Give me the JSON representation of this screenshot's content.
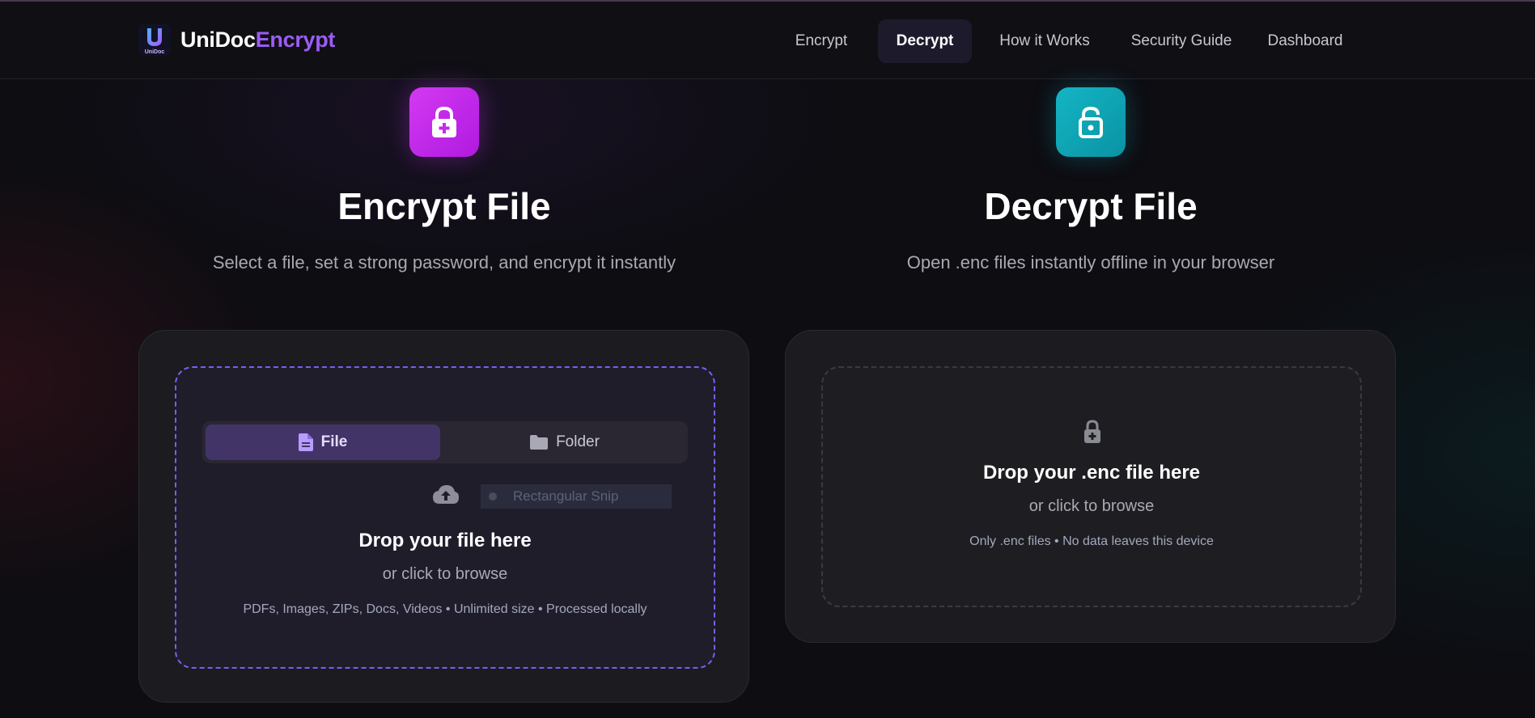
{
  "header": {
    "brand_part1": "UniDoc",
    "brand_part2": "Encrypt",
    "logo_text": "UniDoc",
    "nav": [
      {
        "label": "Encrypt",
        "active": false
      },
      {
        "label": "Decrypt",
        "active": true
      },
      {
        "label": "How it Works",
        "active": false
      },
      {
        "label": "Security Guide",
        "active": false
      },
      {
        "label": "Dashboard",
        "active": false
      }
    ]
  },
  "encrypt": {
    "icon": "lock-plus-icon",
    "title": "Encrypt File",
    "subtitle": "Select a file, set a strong password, and encrypt it instantly",
    "tabs": {
      "file": "File",
      "folder": "Folder"
    },
    "overlay_text": "Rectangular Snip",
    "drop_title": "Drop your file here",
    "drop_sub": "or click to browse",
    "drop_note": "PDFs, Images, ZIPs, Docs, Videos • Unlimited size • Processed locally"
  },
  "decrypt": {
    "icon": "unlock-icon",
    "title": "Decrypt File",
    "subtitle": "Open .enc files instantly offline in your browser",
    "drop_title": "Drop your .enc file here",
    "drop_sub": "or click to browse",
    "drop_note": "Only .enc files • No data leaves this device"
  },
  "colors": {
    "accent_purple": "#9b5cf5",
    "encrypt_tile": "#c62ae8",
    "decrypt_tile": "#12a6b6",
    "dashed_purple": "#7c5df0"
  }
}
